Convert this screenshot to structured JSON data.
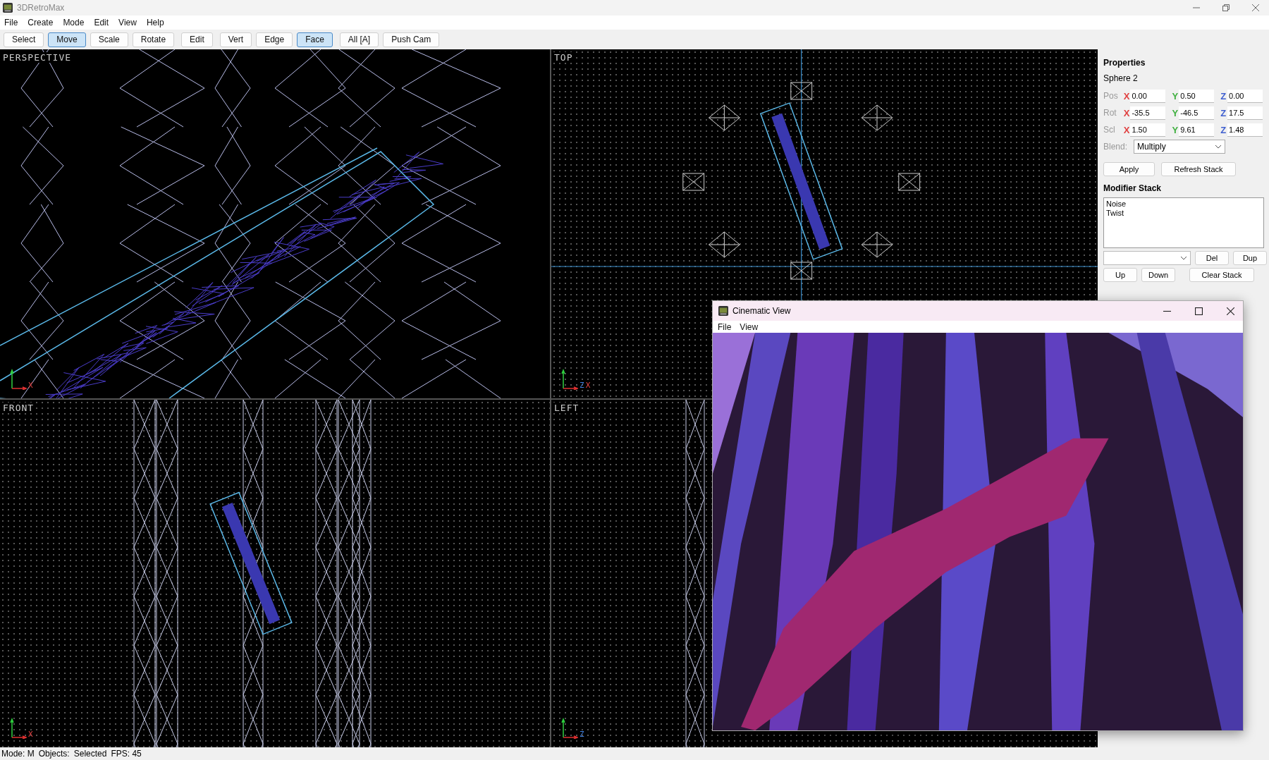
{
  "window": {
    "title": "3DRetroMax"
  },
  "menu": [
    "File",
    "Create",
    "Mode",
    "Edit",
    "View",
    "Help"
  ],
  "toolbar": [
    [
      {
        "label": "Select",
        "selected": false
      },
      {
        "label": "Move",
        "selected": true
      },
      {
        "label": "Scale",
        "selected": false
      },
      {
        "label": "Rotate",
        "selected": false
      }
    ],
    [
      {
        "label": "Edit",
        "selected": false
      }
    ],
    [
      {
        "label": "Vert",
        "selected": false
      },
      {
        "label": "Edge",
        "selected": false
      },
      {
        "label": "Face",
        "selected": true
      }
    ],
    [
      {
        "label": "All [A]",
        "selected": false
      },
      {
        "label": "Push Cam",
        "selected": false
      }
    ]
  ],
  "viewports": [
    {
      "kind": "perspective",
      "label": "PERSPECTIVE",
      "axes": [
        "X"
      ]
    },
    {
      "kind": "top",
      "label": "TOP",
      "axes": [
        "Z",
        "X"
      ]
    },
    {
      "kind": "front",
      "label": "FRONT",
      "axes": [
        "X"
      ]
    },
    {
      "kind": "left",
      "label": "LEFT",
      "axes": [
        "Z"
      ]
    }
  ],
  "properties": {
    "title": "Properties",
    "object": "Sphere 2",
    "rows": [
      {
        "label": "Pos",
        "fields": [
          {
            "axis": "X",
            "color": "#e04040",
            "value": "0.00"
          },
          {
            "axis": "Y",
            "color": "#40b040",
            "value": "0.50"
          },
          {
            "axis": "Z",
            "color": "#4060d0",
            "value": "0.00"
          }
        ]
      },
      {
        "label": "Rot",
        "fields": [
          {
            "axis": "X",
            "color": "#e04040",
            "value": "-35.5"
          },
          {
            "axis": "Y",
            "color": "#40b040",
            "value": "-46.5"
          },
          {
            "axis": "Z",
            "color": "#4060d0",
            "value": "17.5"
          }
        ]
      },
      {
        "label": "Scl",
        "fields": [
          {
            "axis": "X",
            "color": "#e04040",
            "value": "1.50"
          },
          {
            "axis": "Y",
            "color": "#40b040",
            "value": "9.61"
          },
          {
            "axis": "Z",
            "color": "#4060d0",
            "value": "1.48"
          }
        ]
      }
    ],
    "blend": {
      "label": "Blend:",
      "value": "Multiply"
    },
    "buttons": [
      "Apply",
      "Refresh Stack"
    ],
    "stack_title": "Modifier Stack",
    "stack": [
      "Noise",
      "Twist"
    ],
    "stack_buttons": [
      "Del",
      "Dup"
    ],
    "stack_buttons_2": [
      "Up",
      "Down",
      "Clear Stack"
    ]
  },
  "status_bar": [
    "Mode: M",
    "Objects:",
    "Selected",
    "FPS: 45"
  ],
  "cinematic": {
    "title": "Cinematic View",
    "menu": [
      "File",
      "View"
    ]
  }
}
